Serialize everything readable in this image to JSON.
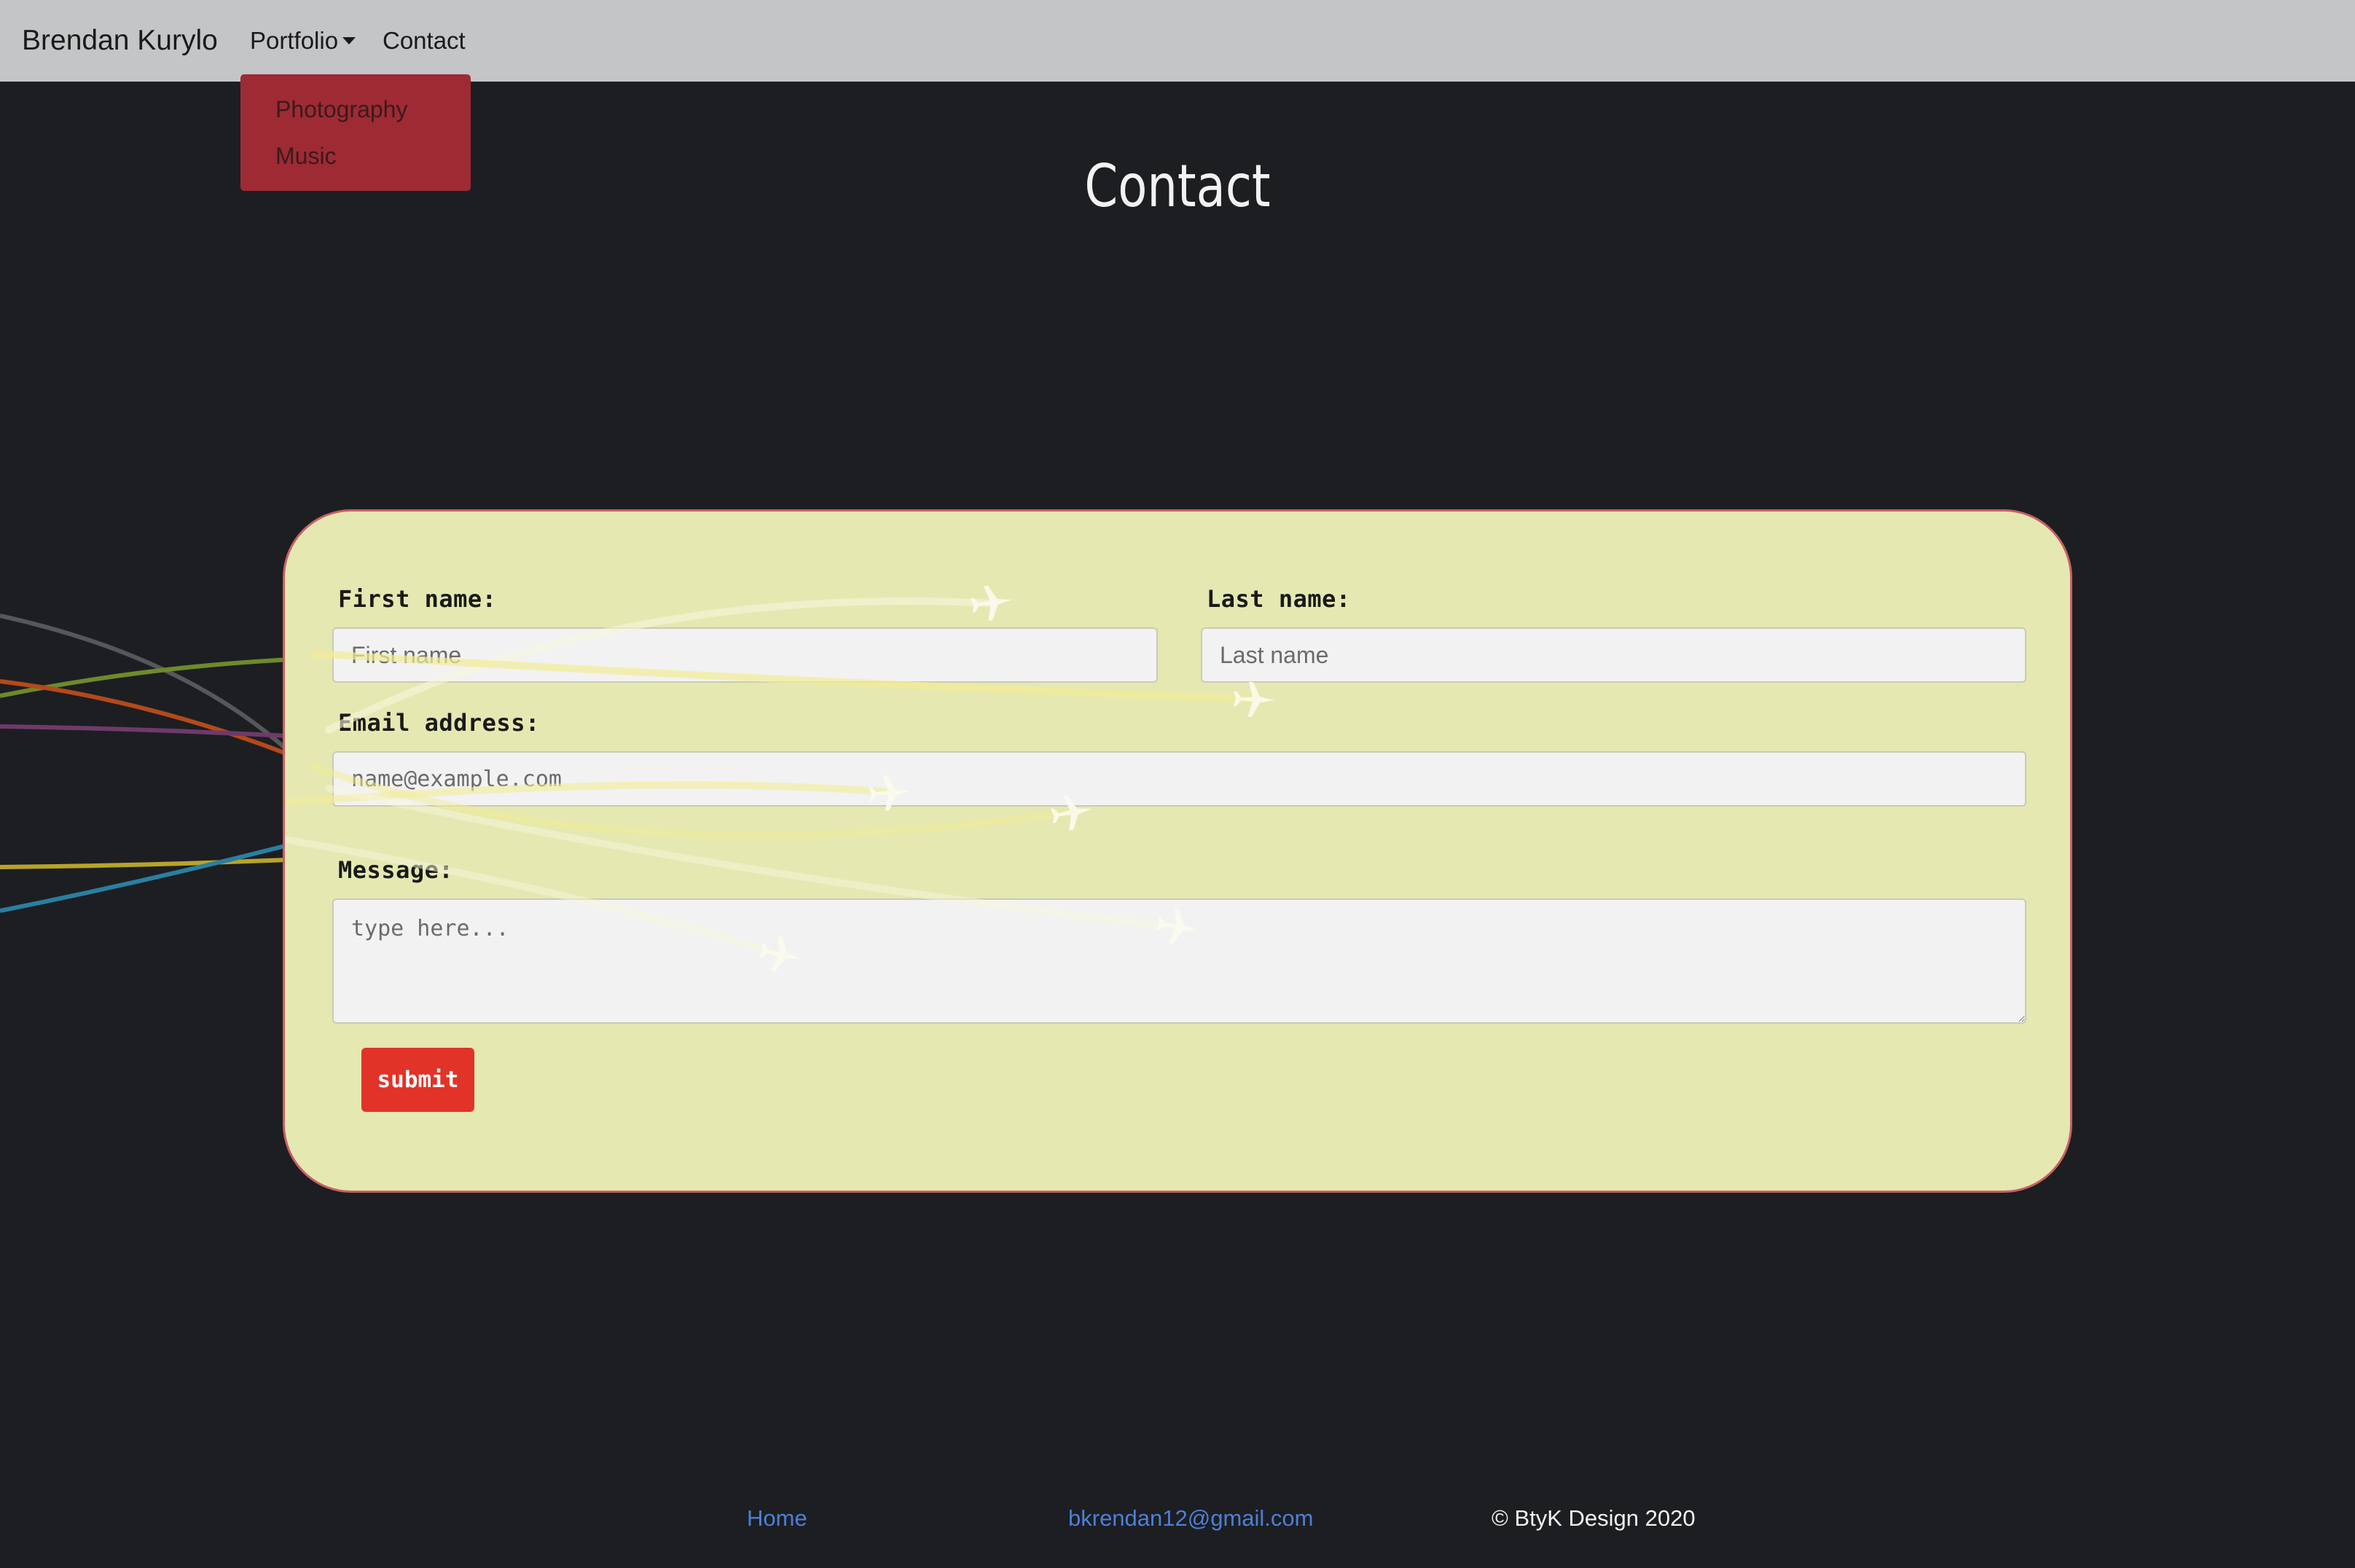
{
  "navbar": {
    "brand": "Brendan Kurylo",
    "portfolio_label": "Portfolio",
    "contact_label": "Contact"
  },
  "dropdown": {
    "items": [
      {
        "label": "Photography"
      },
      {
        "label": "Music"
      }
    ]
  },
  "page": {
    "title": "Contact"
  },
  "form": {
    "first_name": {
      "label": "First name:",
      "placeholder": "First name",
      "value": ""
    },
    "last_name": {
      "label": "Last name:",
      "placeholder": "Last name",
      "value": ""
    },
    "email": {
      "label": "Email address:",
      "placeholder": "name@example.com",
      "value": ""
    },
    "message": {
      "label": "Message:",
      "placeholder": "type here...",
      "value": ""
    },
    "submit_label": "submit"
  },
  "footer": {
    "home": "Home",
    "email": "bkrendan12@gmail.com",
    "copyright": "© BtyK Design 2020"
  },
  "colors": {
    "page_background": "#1d1e22",
    "navbar_background": "#c4c5c7",
    "dropdown_background": "#9e2a34",
    "card_background": "#e5e8b1",
    "card_border": "#c76065",
    "submit_background": "#e13328",
    "footer_link": "#4d7fd6"
  },
  "icons": {
    "dropdown_caret": "caret-down-icon",
    "decoration": "airplane-icon"
  }
}
